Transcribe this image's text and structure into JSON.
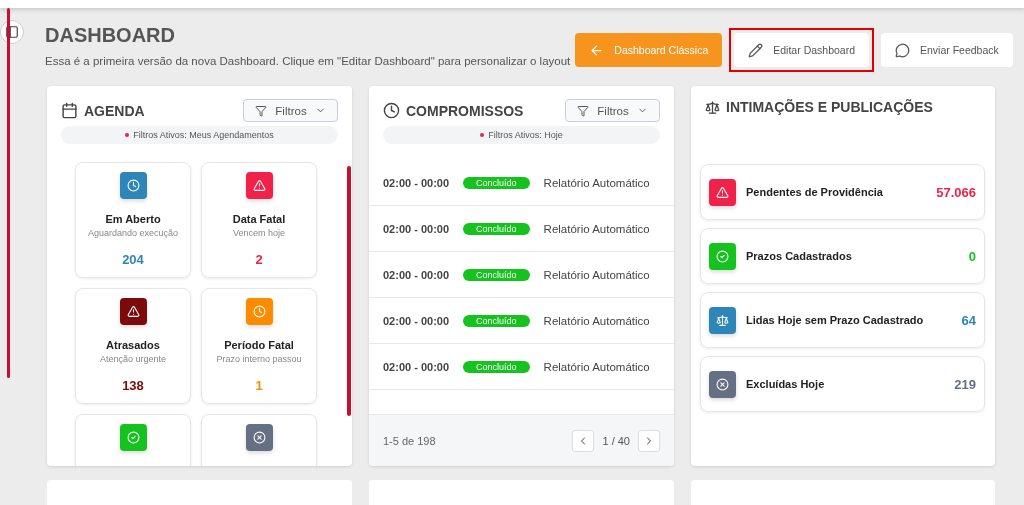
{
  "header": {
    "title": "DASHBOARD",
    "subtitle": "Essa é a primeira versão da nova Dashboard. Clique em \"Editar Dashboard\" para personalizar o layout"
  },
  "actions": [
    {
      "kind": "back",
      "label": "Dashboard Clássica",
      "primary": true,
      "highlighted": false
    },
    {
      "kind": "edit",
      "label": "Editar Dashboard",
      "primary": false,
      "highlighted": true
    },
    {
      "kind": "feedback",
      "label": "Enviar Feedback",
      "primary": false,
      "highlighted": false
    }
  ],
  "agenda": {
    "title": "AGENDA",
    "filter_button": "Filtros",
    "active_filters": "Filtros Ativos: Meus Agendamentos",
    "tiles": [
      {
        "kind": "clock",
        "color": "#2e86b8",
        "title": "Em Aberto",
        "subtitle": "Aguardando execução",
        "count": "204"
      },
      {
        "kind": "alert",
        "color": "#f0224a",
        "title": "Data Fatal",
        "subtitle": "Vencem hoje",
        "count": "2"
      },
      {
        "kind": "alert",
        "color": "#7d0a0a",
        "title": "Atrasados",
        "subtitle": "Atenção urgente",
        "count": "138"
      },
      {
        "kind": "clock",
        "color": "#fb8c00",
        "title": "Período Fatal",
        "subtitle": "Prazo interno passou",
        "count": "1"
      },
      {
        "kind": "check",
        "color": "#16c21e"
      },
      {
        "kind": "cancel",
        "color": "#667085"
      }
    ]
  },
  "compromissos": {
    "title": "COMPROMISSOS",
    "filter_button": "Filtros",
    "active_filters": "Filtros Ativos: Hoje",
    "rows": [
      {
        "time": "02:00 - 00:00",
        "status": "Concluído",
        "description": "Relatório Automático"
      },
      {
        "time": "02:00 - 00:00",
        "status": "Concluído",
        "description": "Relatório Automático"
      },
      {
        "time": "02:00 - 00:00",
        "status": "Concluído",
        "description": "Relatório Automático"
      },
      {
        "time": "02:00 - 00:00",
        "status": "Concluído",
        "description": "Relatório Automático"
      },
      {
        "time": "02:00 - 00:00",
        "status": "Concluído",
        "description": "Relatório Automático"
      }
    ],
    "range": "1-5 de 198",
    "page": "1 / 40"
  },
  "intimacoes": {
    "title": "INTIMAÇÕES E PUBLICAÇÕES",
    "items": [
      {
        "kind": "alert",
        "color": "#f0224a",
        "label": "Pendentes de Providência",
        "count": "57.066"
      },
      {
        "kind": "check",
        "color": "#16c21e",
        "label": "Prazos Cadastrados",
        "count": "0"
      },
      {
        "kind": "scale",
        "color": "#2e86b8",
        "label": "Lidas Hoje sem Prazo Cadastrado",
        "count": "64"
      },
      {
        "kind": "cancel",
        "color": "#667085",
        "label": "Excluídas Hoje",
        "count": "219"
      }
    ]
  }
}
